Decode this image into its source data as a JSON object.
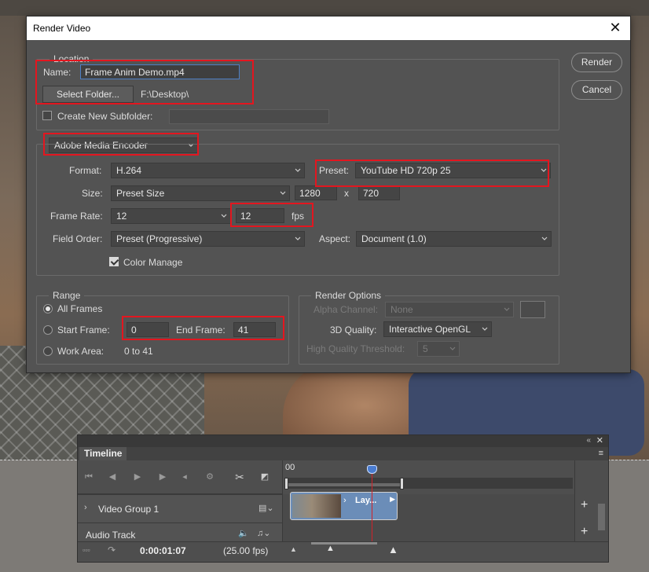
{
  "dialog": {
    "title": "Render Video",
    "render_label": "Render",
    "cancel_label": "Cancel",
    "location": {
      "legend": "Location",
      "name_label": "Name:",
      "name_value": "Frame Anim Demo.mp4",
      "select_folder_label": "Select Folder...",
      "folder_path": "F:\\Desktop\\",
      "subfolder_label": "Create New Subfolder:",
      "subfolder_checked": false,
      "subfolder_value": ""
    },
    "encoder": {
      "selected": "Adobe Media Encoder",
      "format_label": "Format:",
      "format_value": "H.264",
      "preset_label": "Preset:",
      "preset_value": "YouTube HD 720p 25",
      "size_label": "Size:",
      "size_value": "Preset Size",
      "width": "1280",
      "x_sep": "x",
      "height": "720",
      "frame_rate_label": "Frame Rate:",
      "frame_rate_value": "12",
      "fps_value": "12",
      "fps_unit": "fps",
      "field_order_label": "Field Order:",
      "field_order_value": "Preset (Progressive)",
      "aspect_label": "Aspect:",
      "aspect_value": "Document (1.0)",
      "color_manage_label": "Color Manage",
      "color_manage_checked": true
    },
    "range": {
      "legend": "Range",
      "all_frames_label": "All Frames",
      "start_frame_label": "Start Frame:",
      "start_frame_value": "0",
      "end_frame_label": "End Frame:",
      "end_frame_value": "41",
      "work_area_label": "Work Area:",
      "work_area_value": "0 to 41",
      "selected": "all_frames"
    },
    "render_options": {
      "legend": "Render Options",
      "alpha_label": "Alpha Channel:",
      "alpha_value": "None",
      "quality_label": "3D Quality:",
      "quality_value": "Interactive OpenGL",
      "threshold_label": "High Quality Threshold:",
      "threshold_value": "5"
    }
  },
  "timeline": {
    "tab_label": "Timeline",
    "ruler_start": "00",
    "video_group_label": "Video Group 1",
    "clip_label": "Lay...",
    "audio_track_label": "Audio Track",
    "timecode": "0:00:01:07",
    "fps_readout": "(25.00 fps)"
  },
  "colors": {
    "dialog_bg": "#535353",
    "highlight_red": "#e3161f",
    "focus_blue": "#4d7fc4",
    "clip_blue": "#6b8db8",
    "playhead_red": "#d0232a"
  }
}
